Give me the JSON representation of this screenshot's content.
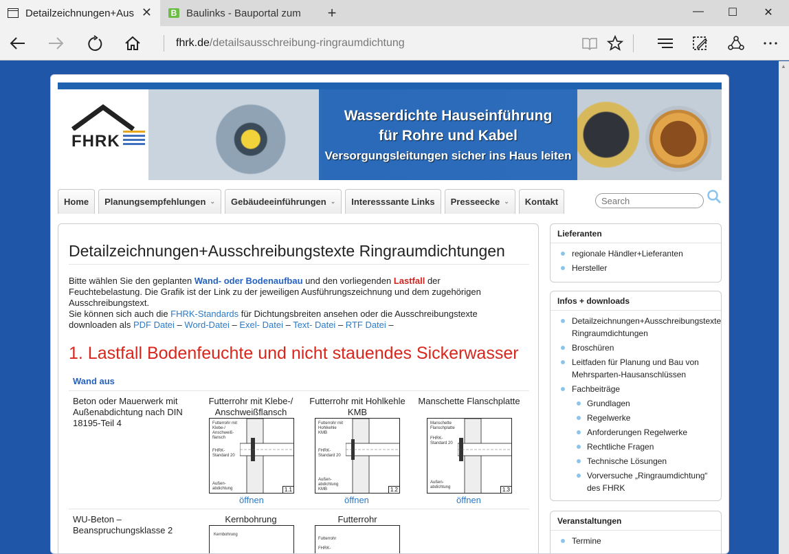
{
  "browser": {
    "tabs": [
      {
        "title": "Detailzeichnungen+Aus",
        "active": true,
        "icon": "page-icon"
      },
      {
        "title": "Baulinks - Bauportal zum Pl",
        "active": false,
        "icon": "baulinks-favicon",
        "favicon_letter": "B"
      }
    ],
    "url_host": "fhrk.de",
    "url_path": "/detailsausschreibung-ringraumdichtung"
  },
  "banner": {
    "logo_text": "FHRK",
    "line1": "Wasserdichte Hauseinführung",
    "line2": "für Rohre und Kabel",
    "line3": "Versorgungsleitungen sicher ins Haus leiten"
  },
  "menu": {
    "items": [
      {
        "label": "Home",
        "dropdown": false
      },
      {
        "label": "Planungsempfehlungen",
        "dropdown": true
      },
      {
        "label": "Gebäudeeinführungen",
        "dropdown": true
      },
      {
        "label": "Interesssante Links",
        "dropdown": false
      },
      {
        "label": "Presseecke",
        "dropdown": true
      },
      {
        "label": "Kontakt",
        "dropdown": false
      }
    ],
    "search_placeholder": "Search"
  },
  "main": {
    "title": "Detailzeichnungen+Ausschreibungstexte Ringraumdichtungen",
    "intro": {
      "p1_a": "Bitte wählen Sie den geplanten ",
      "p1_kw1": "Wand- oder Bodenaufbau",
      "p1_b": " und den vorliegenden ",
      "p1_kw2": "Lastfall",
      "p1_c": " der Feuchtebelastung. Die Grafik ist der Link zu der jeweiligen Ausführungszeichnung und dem zugehörigen Ausschreibungstext.",
      "p2_a": "Sie können sich auch die ",
      "p2_link": "FHRK-Standards",
      "p2_b": " für Dichtungsbreiten ansehen oder  die Ausschreibungstexte downloaden als ",
      "dl_pdf": "PDF Datei",
      "dl_word": "Word-Datei",
      "dl_excel": "Exel- Datei",
      "dl_text": "Text- Datei",
      "dl_rtf": "RTF Datei",
      "dash": " – "
    },
    "case_title": "1. Lastfall Bodenfeuchte und nicht stauendes Sickerwasser",
    "wand_aus": "Wand aus",
    "rows": [
      {
        "label": "Beton oder Mauerwerk mit Außenabdichtung nach DIN 18195-Teil 4",
        "cells": [
          {
            "title": "Futterrohr mit Klebe-/ Anschweißflansch",
            "drawing_label": "Futterrohr mit Klebe-/ Anschweiß-flansch",
            "standard_label": "FHRK-Standard 20",
            "bottom_label": "Außen-abdichtung",
            "number": "1.1",
            "link": "öffnen"
          },
          {
            "title": "Futterrohr mit Hohlkehle KMB",
            "drawing_label": "Futterrohr mit Hohlkehle KMB",
            "standard_label": "FHRK-Standard 20",
            "bottom_label": "Außen-abdichtung KMB",
            "number": "1.2",
            "link": "öffnen"
          },
          {
            "title": "Manschette Flanschplatte",
            "drawing_label": "Manschette Flanschplatte",
            "standard_label": "FHRK-Standard 20",
            "bottom_label": "Außen-abdichtung",
            "number": "1.3",
            "link": "öffnen"
          }
        ]
      },
      {
        "label": "WU-Beton – Beanspruchungsklasse 2",
        "cells": [
          {
            "title": "Kernbohrung",
            "drawing_label": "Kernbohrung"
          },
          {
            "title": "Futterrohr",
            "drawing_label": "Futterrohr",
            "standard_label": "FHRK-"
          }
        ]
      }
    ]
  },
  "sidebar": {
    "lieferanten": {
      "title": "Lieferanten",
      "items": [
        "regionale Händler+Lieferanten",
        "Hersteller"
      ]
    },
    "infos": {
      "title": "Infos + downloads",
      "items": [
        {
          "label": "Detailzeichnungen+Ausschreibungstexte Ringraumdichtungen",
          "sub": false
        },
        {
          "label": "Broschüren",
          "sub": false
        },
        {
          "label": "Leitfaden für Planung und Bau von Mehrsparten-Hausanschlüssen",
          "sub": false
        },
        {
          "label": "Fachbeiträge",
          "sub": false
        },
        {
          "label": "Grundlagen",
          "sub": true
        },
        {
          "label": "Regelwerke",
          "sub": true
        },
        {
          "label": "Anforderungen Regelwerke",
          "sub": true
        },
        {
          "label": "Rechtliche Fragen",
          "sub": true
        },
        {
          "label": "Technische Lösungen",
          "sub": true
        },
        {
          "label": "Vorversuche „Ringraumdichtung“ des FHRK",
          "sub": true
        }
      ]
    },
    "veranstaltungen": {
      "title": "Veranstaltungen",
      "items": [
        "Termine"
      ]
    }
  },
  "colors": {
    "page_bg": "#1f56a8",
    "accent_blue": "#2461c0",
    "accent_red": "#d9261c",
    "link_blue": "#2a7ac8",
    "bullet": "#8cc4ec"
  }
}
